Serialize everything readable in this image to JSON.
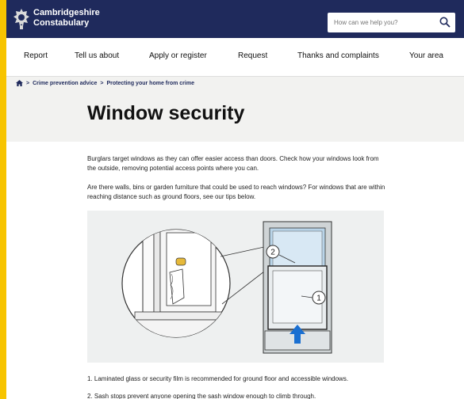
{
  "brand": {
    "line1": "Cambridgeshire",
    "line2": "Constabulary"
  },
  "search": {
    "placeholder": "How can we help you?"
  },
  "nav": [
    {
      "label": "Report"
    },
    {
      "label": "Tell us about"
    },
    {
      "label": "Apply or register"
    },
    {
      "label": "Request"
    },
    {
      "label": "Thanks and complaints"
    },
    {
      "label": "Your area"
    }
  ],
  "breadcrumb": {
    "level1": "Crime prevention advice",
    "level2": "Protecting your home from crime"
  },
  "page_title": "Window security",
  "intro": {
    "p1": "Burglars target windows as they can offer easier access than doors. Check how your windows look from the outside, removing potential access points where you can.",
    "p2": "Are there walls, bins or garden furniture that could be used to reach windows? For windows that are within reaching distance such as ground floors, see our tips below."
  },
  "illustration": {
    "callout_1": "1",
    "callout_2": "2"
  },
  "tips": [
    "1. Laminated glass or security film is recommended for ground floor and accessible windows.",
    "2. Sash stops prevent anyone opening the sash window enough to climb through."
  ],
  "colors": {
    "header": "#1f2a5c",
    "accent": "#f7c400",
    "arrow": "#1a6fd1"
  }
}
